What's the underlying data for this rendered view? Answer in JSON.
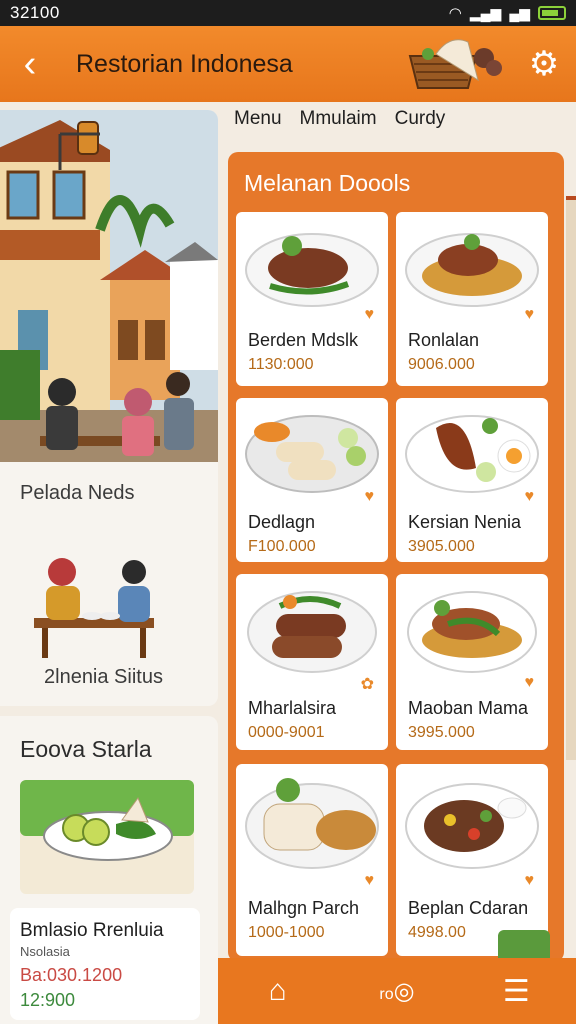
{
  "status": {
    "time": "32100"
  },
  "header": {
    "title": "Restorian Indonesa",
    "back_icon": "chevron-left-icon",
    "settings_icon": "gear-icon"
  },
  "tabs": [
    "Menu",
    "Mmulaim",
    "Curdy"
  ],
  "left": {
    "scene_label": "Pelada Neds",
    "situs_label": "2lnenia Siitus",
    "special": {
      "title": "Eoova Starla",
      "name": "Bmlasio Rrenluia",
      "sub": "Nsolasia",
      "price1": "Ba:030.1200",
      "price2": "12:900"
    }
  },
  "panel": {
    "title": "Melanan Doools",
    "items": [
      {
        "name": "Berden Mdslk",
        "price": "1130:000"
      },
      {
        "name": "Ronlalan",
        "price": "9006.000"
      },
      {
        "name": "Dedlagn",
        "price": "F100.000"
      },
      {
        "name": "Kersian Nenia",
        "price": "3905.000"
      },
      {
        "name": "Mharlalsira",
        "price": "0000-9001"
      },
      {
        "name": "Maoban Mama",
        "price": "3995.000"
      },
      {
        "name": "Malhgn Parch",
        "price": "1000-1000"
      },
      {
        "name": "Beplan Cdaran",
        "price": "4998.00"
      }
    ]
  },
  "nav": {
    "home_icon": "home-icon",
    "middle_label": "ro",
    "menu_icon": "hamburger-icon"
  },
  "colors": {
    "brand_orange": "#e8771f",
    "price_brown": "#b56a18",
    "green": "#5a9a3c"
  }
}
